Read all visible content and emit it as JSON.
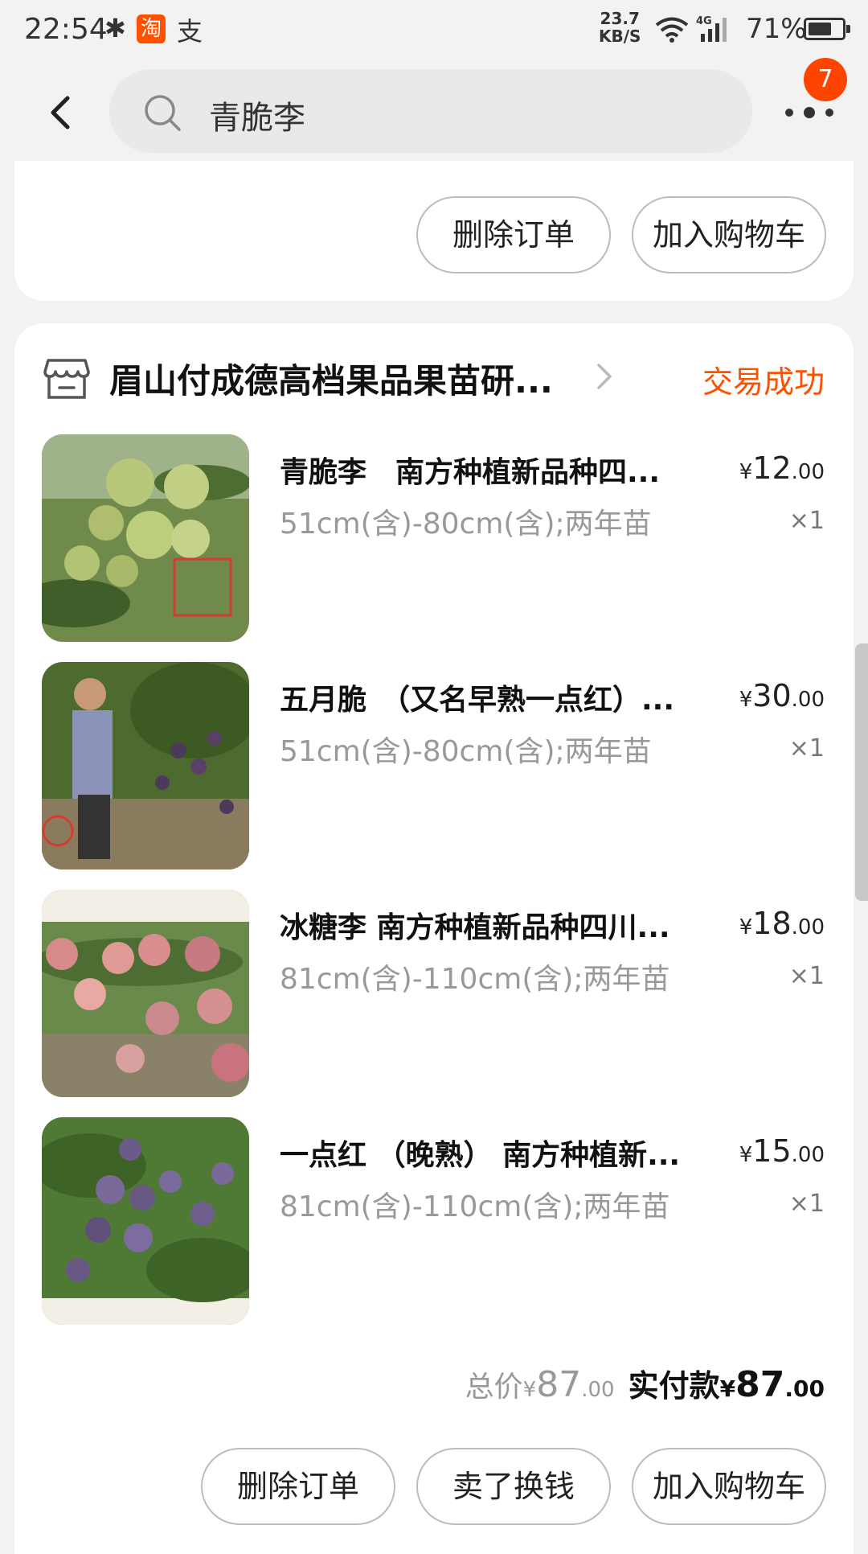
{
  "status_bar": {
    "time": "22:54",
    "taobao_glyph": "淘",
    "alipay_glyph": "支",
    "net_speed_value": "23.7",
    "net_speed_unit": "KB/S",
    "network_type": "4G",
    "battery_percent": "71%",
    "battery_level": 0.71
  },
  "header": {
    "search_query": "青脆李",
    "notification_count": "7",
    "icons": [
      "back-arrow-icon",
      "search-icon",
      "more-dots-icon"
    ]
  },
  "previous_order": {
    "buttons": {
      "delete_order": "删除订单",
      "add_to_cart": "加入购物车"
    }
  },
  "order": {
    "shop_name": "眉山付成德高档果品果苗研...",
    "status": "交易成功",
    "status_color": "#ff5000",
    "items": [
      {
        "title": "青脆李　南方种植新品种四...",
        "spec": "51cm(含)-80cm(含);两年苗",
        "currency": "¥",
        "price_int": "12",
        "price_dec": ".00",
        "qty": "×1"
      },
      {
        "title": "五月脆　（又名早熟一点红）...",
        "spec": "51cm(含)-80cm(含);两年苗",
        "currency": "¥",
        "price_int": "30",
        "price_dec": ".00",
        "qty": "×1"
      },
      {
        "title": "冰糖李  南方种植新品种四川...",
        "spec": "81cm(含)-110cm(含);两年苗",
        "currency": "¥",
        "price_int": "18",
        "price_dec": ".00",
        "qty": "×1"
      },
      {
        "title": "一点红 （晚熟） 南方种植新...",
        "spec": "81cm(含)-110cm(含);两年苗",
        "currency": "¥",
        "price_int": "15",
        "price_dec": ".00",
        "qty": "×1"
      }
    ],
    "total": {
      "label": "总价",
      "currency": "¥",
      "int": "87",
      "dec": ".00"
    },
    "paid": {
      "label": "实付款",
      "currency": "¥",
      "int": "87",
      "dec": ".00"
    },
    "buttons": {
      "delete_order": "删除订单",
      "sell_for_cash": "卖了换钱",
      "add_to_cart": "加入购物车"
    }
  }
}
